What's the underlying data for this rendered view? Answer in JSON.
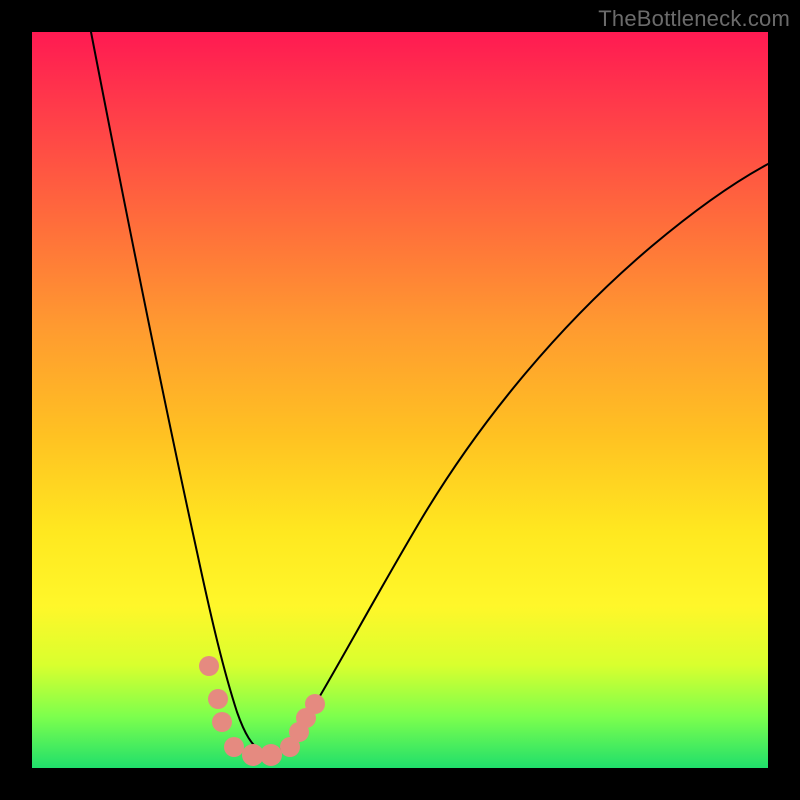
{
  "watermark": "TheBottleneck.com",
  "chart_data": {
    "type": "line",
    "title": "",
    "xlabel": "",
    "ylabel": "",
    "xlim": [
      0,
      100
    ],
    "ylim": [
      0,
      100
    ],
    "grid": false,
    "legend": false,
    "background": "red-yellow-green vertical gradient (bottleneck heatmap)",
    "series": [
      {
        "name": "bottleneck-curve",
        "x": [
          8,
          12,
          16,
          20,
          23,
          25,
          27,
          29,
          31,
          33,
          36,
          40,
          45,
          52,
          60,
          70,
          82,
          98
        ],
        "y": [
          100,
          79,
          58,
          38,
          24,
          15,
          8,
          4,
          2,
          2,
          3,
          6,
          12,
          22,
          34,
          47,
          60,
          75
        ]
      }
    ],
    "markers": [
      {
        "x": 24.0,
        "y": 14.0,
        "r": 1.4
      },
      {
        "x": 25.3,
        "y": 9.5,
        "r": 1.4
      },
      {
        "x": 25.9,
        "y": 6.5,
        "r": 1.4
      },
      {
        "x": 27.5,
        "y": 3.0,
        "r": 1.4
      },
      {
        "x": 30.0,
        "y": 1.7,
        "r": 1.6
      },
      {
        "x": 32.5,
        "y": 1.7,
        "r": 1.6
      },
      {
        "x": 35.0,
        "y": 3.0,
        "r": 1.4
      },
      {
        "x": 36.3,
        "y": 5.0,
        "r": 1.4
      },
      {
        "x": 37.3,
        "y": 7.0,
        "r": 1.4
      },
      {
        "x": 38.5,
        "y": 9.0,
        "r": 1.4
      }
    ]
  }
}
